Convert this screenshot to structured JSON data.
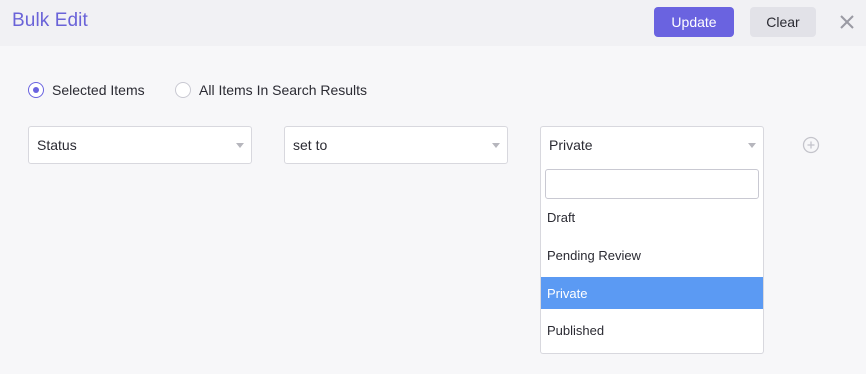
{
  "header": {
    "title": "Bulk Edit",
    "update_label": "Update",
    "clear_label": "Clear",
    "close_icon": "close-icon"
  },
  "scope": {
    "options": [
      {
        "label": "Selected Items",
        "checked": true
      },
      {
        "label": "All Items In Search Results",
        "checked": false
      }
    ]
  },
  "rule": {
    "field": "Status",
    "operator": "set to",
    "value": "Private",
    "add_icon": "plus-circle-icon"
  },
  "dropdown": {
    "search_value": "",
    "options": [
      "Draft",
      "Pending Review",
      "Private",
      "Published"
    ],
    "highlighted": "Private"
  },
  "colors": {
    "accent": "#6a63e0",
    "highlight": "#5b9af3"
  }
}
